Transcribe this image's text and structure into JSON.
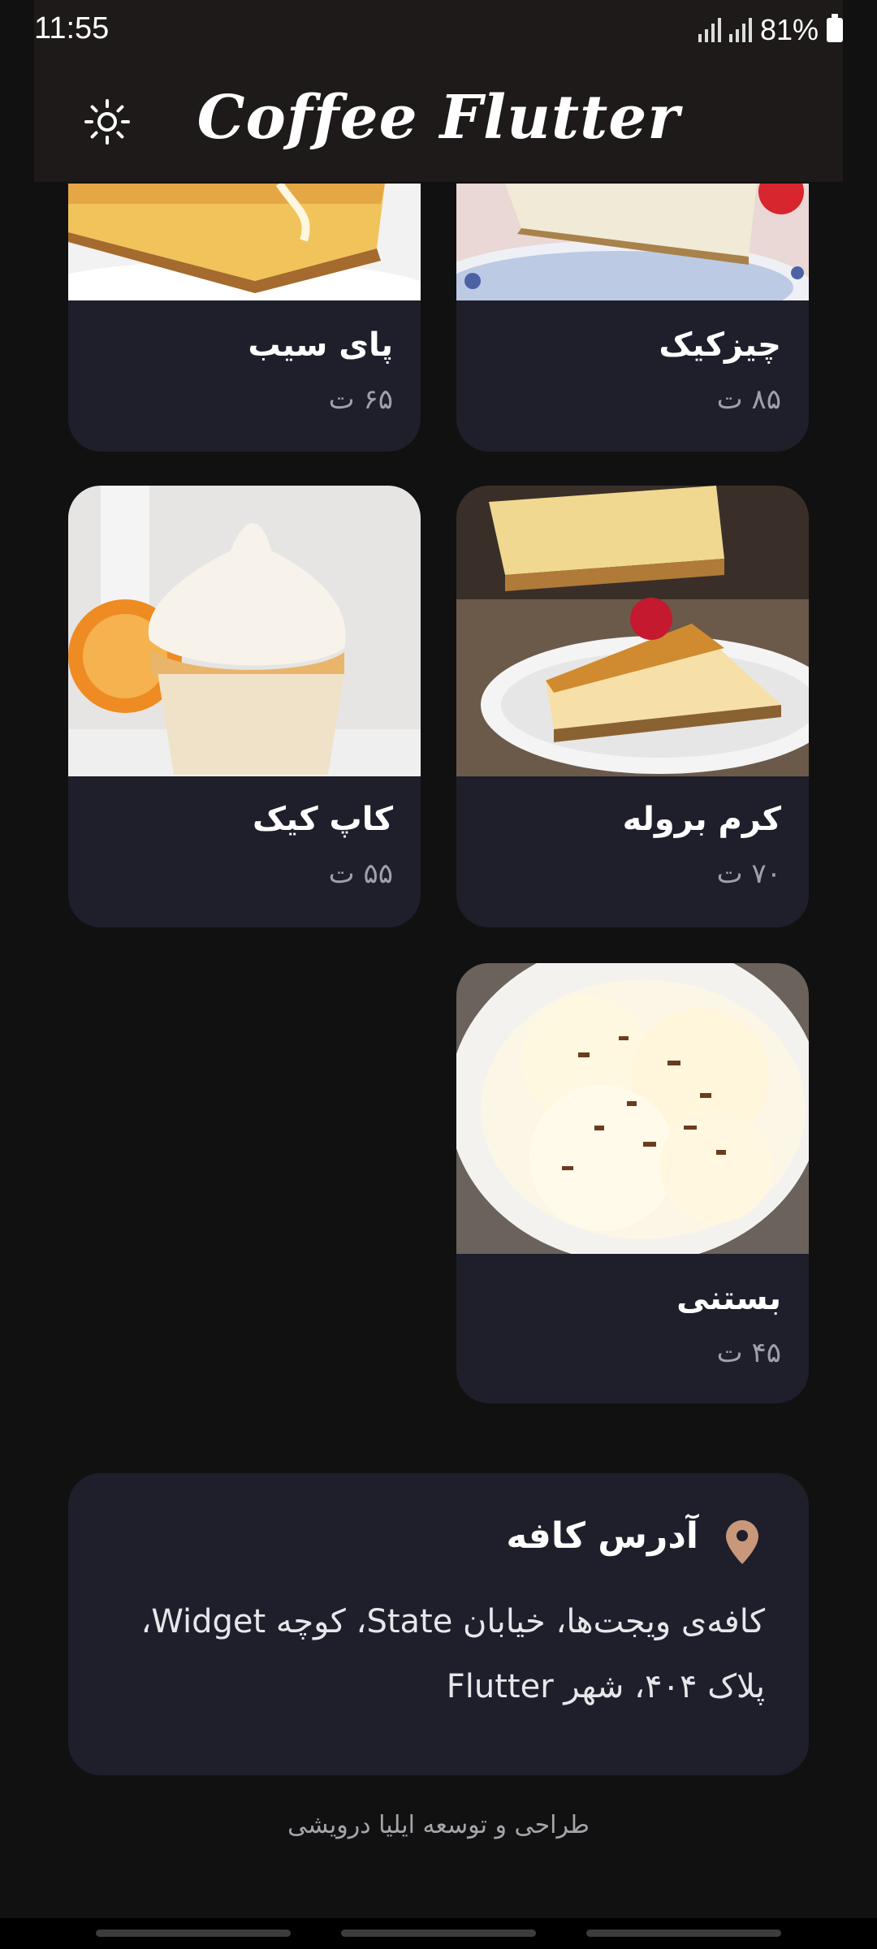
{
  "status_bar": {
    "time": "11:55",
    "battery": "81%"
  },
  "app_bar": {
    "title": "Coffee Flutter",
    "theme_icon": "sun-icon"
  },
  "menu_items": [
    {
      "name": "چیزکیک",
      "price": "۸۵ ت",
      "image": "cheesecake"
    },
    {
      "name": "پای سیب",
      "price": "۶۵ ت",
      "image": "apple-pie"
    },
    {
      "name": "کرم بروله",
      "price": "۷۰ ت",
      "image": "creme-brulee"
    },
    {
      "name": "کاپ کیک",
      "price": "۵۵ ت",
      "image": "cupcake"
    },
    {
      "name": "بستنی",
      "price": "۴۵ ت",
      "image": "ice-cream"
    }
  ],
  "address": {
    "title": "آدرس کافه",
    "line1": "کافه‌ی ویجت‌ها، خیابان State، کوچه Widget،",
    "line2": "پلاک ۴۰۴، شهر Flutter",
    "icon": "location-pin-icon",
    "accent_color": "#c9977a"
  },
  "footer": {
    "credit": "طراحی و توسعه ایلیا درویشی"
  },
  "colors": {
    "background": "#111112",
    "card": "#1e1f2b",
    "appbar": "#1d1a19",
    "price": "#9ea0aa"
  }
}
